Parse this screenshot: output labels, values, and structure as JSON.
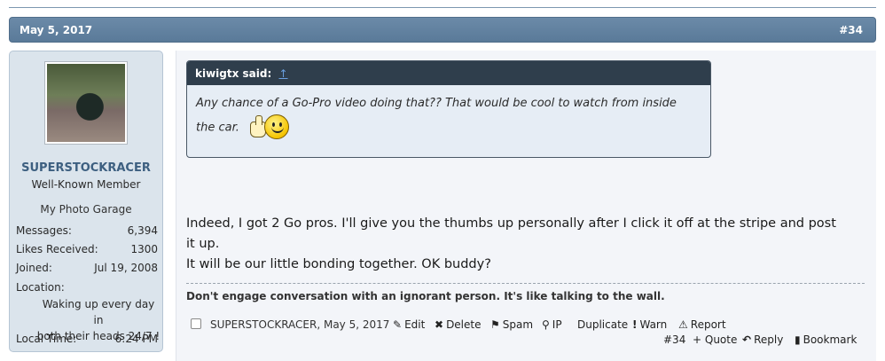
{
  "header": {
    "date": "May 5, 2017",
    "post_number": "#34"
  },
  "user": {
    "name": "SUPERSTOCKRACER",
    "title": "Well-Known Member",
    "garage_link": "My Photo Garage",
    "stats": [
      {
        "key": "Messages:",
        "value": "6,394"
      },
      {
        "key": "Likes Received:",
        "value": "1300"
      },
      {
        "key": "Joined:",
        "value": "Jul 19, 2008"
      }
    ],
    "location_label": "Location:",
    "location_line1": "Waking up every day in",
    "location_line2": "both their heads 24/7 !",
    "local_time_label": "Local Time:",
    "local_time_value": "6:24 PM"
  },
  "quote": {
    "author": "kiwigtx said:",
    "arrow": "↑",
    "text_line1": "Any chance of a Go-Pro video doing that?? That would be cool to watch from inside",
    "text_line2": "the car."
  },
  "message": {
    "line1": "Indeed, I got 2 Go pros. I'll give you the thumbs up personally after I click it off at the stripe and post",
    "line2": "it up.",
    "line3": "It will be our little bonding together. OK buddy?"
  },
  "signature": "Don't engage conversation with an ignorant person. It's like talking to the wall.",
  "footer": {
    "author_date": "SUPERSTOCKRACER, May 5, 2017",
    "edit": "Edit",
    "delete": "Delete",
    "spam": "Spam",
    "ip": "IP",
    "duplicate": "Duplicate",
    "warn": "Warn",
    "report": "Report",
    "permalink": "#34",
    "quote": "+ Quote",
    "reply": "Reply",
    "bookmark": "Bookmark"
  }
}
